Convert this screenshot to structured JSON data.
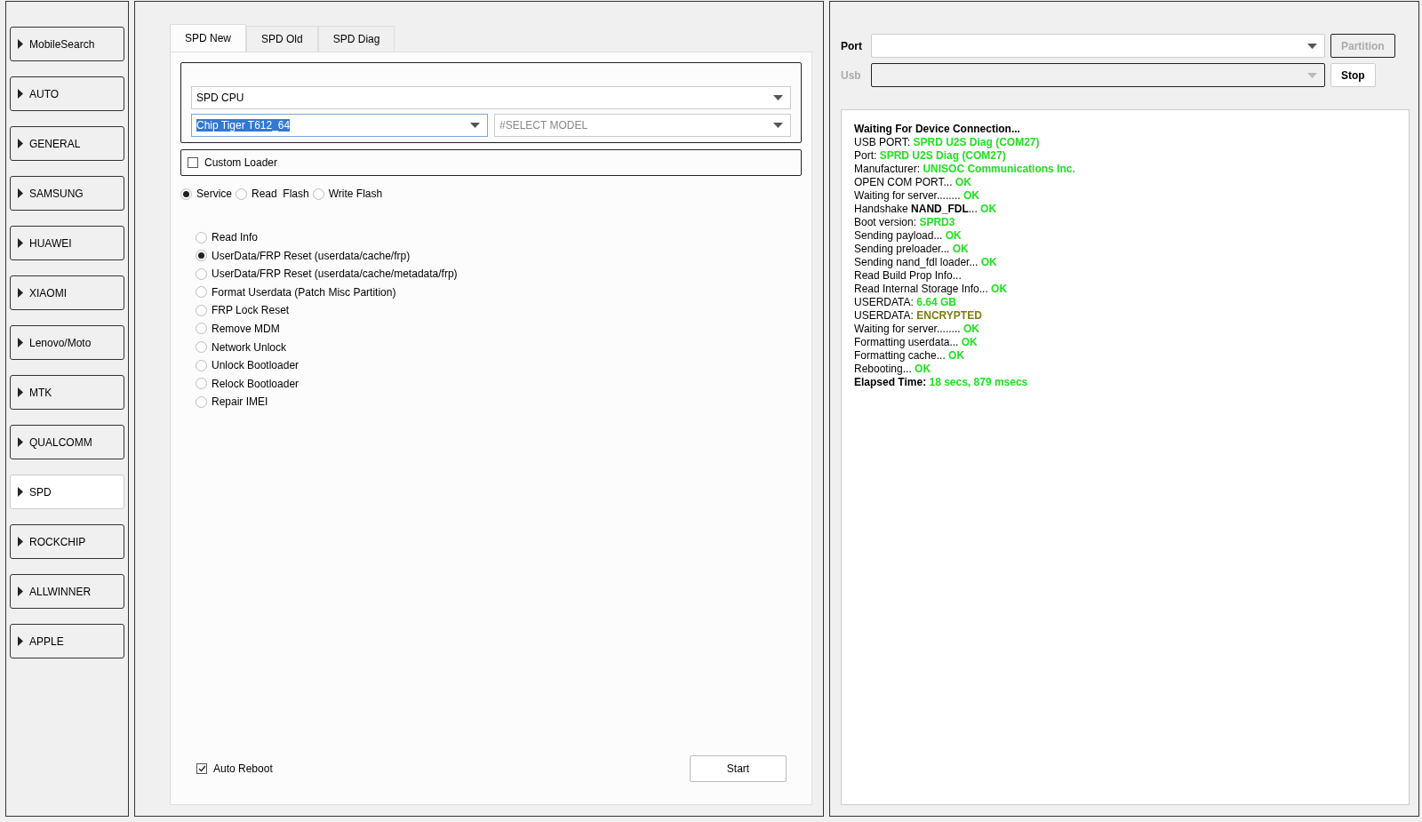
{
  "sidebar": {
    "items": [
      {
        "label": "MobileSearch",
        "selected": false
      },
      {
        "label": "AUTO",
        "selected": false
      },
      {
        "label": "GENERAL",
        "selected": false
      },
      {
        "label": "SAMSUNG",
        "selected": false
      },
      {
        "label": "HUAWEI",
        "selected": false
      },
      {
        "label": "XIAOMI",
        "selected": false
      },
      {
        "label": "Lenovo/Moto",
        "selected": false
      },
      {
        "label": "MTK",
        "selected": false
      },
      {
        "label": "QUALCOMM",
        "selected": false
      },
      {
        "label": "SPD",
        "selected": true
      },
      {
        "label": "ROCKCHIP",
        "selected": false
      },
      {
        "label": "ALLWINNER",
        "selected": false
      },
      {
        "label": "APPLE",
        "selected": false
      }
    ]
  },
  "tabs": [
    {
      "label": "SPD New",
      "selected": true
    },
    {
      "label": "SPD Old",
      "selected": false
    },
    {
      "label": "SPD Diag",
      "selected": false
    }
  ],
  "cpu_select": {
    "value": "SPD CPU"
  },
  "chip_select": {
    "value": "Chip Tiger T612_64"
  },
  "model_select": {
    "placeholder": "#SELECT MODEL"
  },
  "custom_loader": {
    "label": "Custom Loader",
    "checked": false
  },
  "modes": [
    {
      "label": "Service",
      "selected": true
    },
    {
      "label": "Read  Flash",
      "selected": false
    },
    {
      "label": "Write Flash",
      "selected": false
    }
  ],
  "operations": [
    {
      "label": "Read Info",
      "selected": false
    },
    {
      "label": "UserData/FRP Reset (userdata/cache/frp)",
      "selected": true
    },
    {
      "label": "UserData/FRP Reset (userdata/cache/metadata/frp)",
      "selected": false
    },
    {
      "label": "Format Userdata (Patch Misc Partition)",
      "selected": false
    },
    {
      "label": "FRP Lock Reset",
      "selected": false
    },
    {
      "label": "Remove MDM",
      "selected": false
    },
    {
      "label": "Network Unlock",
      "selected": false
    },
    {
      "label": "Unlock Bootloader",
      "selected": false
    },
    {
      "label": "Relock Bootloader",
      "selected": false
    },
    {
      "label": "Repair IMEI",
      "selected": false
    }
  ],
  "auto_reboot": {
    "label": "Auto Reboot",
    "checked": true
  },
  "start_button": {
    "label": "Start"
  },
  "port": {
    "label": "Port",
    "disabled": false
  },
  "partition_button": {
    "label": "Partition",
    "disabled": true
  },
  "usb": {
    "label": "Usb",
    "disabled": true
  },
  "stop_button": {
    "label": "Stop",
    "disabled": false
  },
  "log": [
    [
      {
        "text": "Waiting For Device Connection...",
        "kind": "bold"
      }
    ],
    [
      {
        "text": "USB PORT: ",
        "kind": "plain"
      },
      {
        "text": "SPRD U2S Diag (COM27)",
        "kind": "ok"
      }
    ],
    [
      {
        "text": "Port: ",
        "kind": "plain"
      },
      {
        "text": "SPRD U2S Diag (COM27)",
        "kind": "ok"
      }
    ],
    [
      {
        "text": "Manufacturer: ",
        "kind": "plain"
      },
      {
        "text": "UNISOC Communications Inc.",
        "kind": "ok"
      }
    ],
    [
      {
        "text": "OPEN COM PORT... ",
        "kind": "plain"
      },
      {
        "text": "OK",
        "kind": "ok"
      }
    ],
    [
      {
        "text": "Waiting for server........ ",
        "kind": "plain"
      },
      {
        "text": "OK",
        "kind": "ok"
      }
    ],
    [
      {
        "text": "Handshake ",
        "kind": "plain"
      },
      {
        "text": "NAND_FDL",
        "kind": "bold"
      },
      {
        "text": "... ",
        "kind": "plain"
      },
      {
        "text": "OK",
        "kind": "ok"
      }
    ],
    [
      {
        "text": "Boot version: ",
        "kind": "plain"
      },
      {
        "text": "SPRD3",
        "kind": "ok"
      }
    ],
    [
      {
        "text": "Sending payload... ",
        "kind": "plain"
      },
      {
        "text": "OK",
        "kind": "ok"
      }
    ],
    [
      {
        "text": "Sending preloader... ",
        "kind": "plain"
      },
      {
        "text": "OK",
        "kind": "ok"
      }
    ],
    [
      {
        "text": "Sending nand_fdl loader... ",
        "kind": "plain"
      },
      {
        "text": "OK",
        "kind": "ok"
      }
    ],
    [
      {
        "text": "Read Build Prop Info...",
        "kind": "plain"
      }
    ],
    [
      {
        "text": "Read Internal Storage Info... ",
        "kind": "plain"
      },
      {
        "text": "OK",
        "kind": "ok"
      }
    ],
    [
      {
        "text": "USERDATA: ",
        "kind": "plain"
      },
      {
        "text": "6.64 GB",
        "kind": "ok"
      }
    ],
    [
      {
        "text": "USERDATA: ",
        "kind": "plain"
      },
      {
        "text": "ENCRYPTED",
        "kind": "warn"
      }
    ],
    [
      {
        "text": "Waiting for server........ ",
        "kind": "plain"
      },
      {
        "text": "OK",
        "kind": "ok"
      }
    ],
    [
      {
        "text": "Formatting userdata... ",
        "kind": "plain"
      },
      {
        "text": "OK",
        "kind": "ok"
      }
    ],
    [
      {
        "text": "Formatting cache... ",
        "kind": "plain"
      },
      {
        "text": "OK",
        "kind": "ok"
      }
    ],
    [
      {
        "text": "Rebooting... ",
        "kind": "plain"
      },
      {
        "text": "OK",
        "kind": "ok"
      }
    ],
    [
      {
        "text": "Elapsed Time: ",
        "kind": "bold"
      },
      {
        "text": "18 secs, 879 msecs",
        "kind": "ok"
      }
    ]
  ]
}
